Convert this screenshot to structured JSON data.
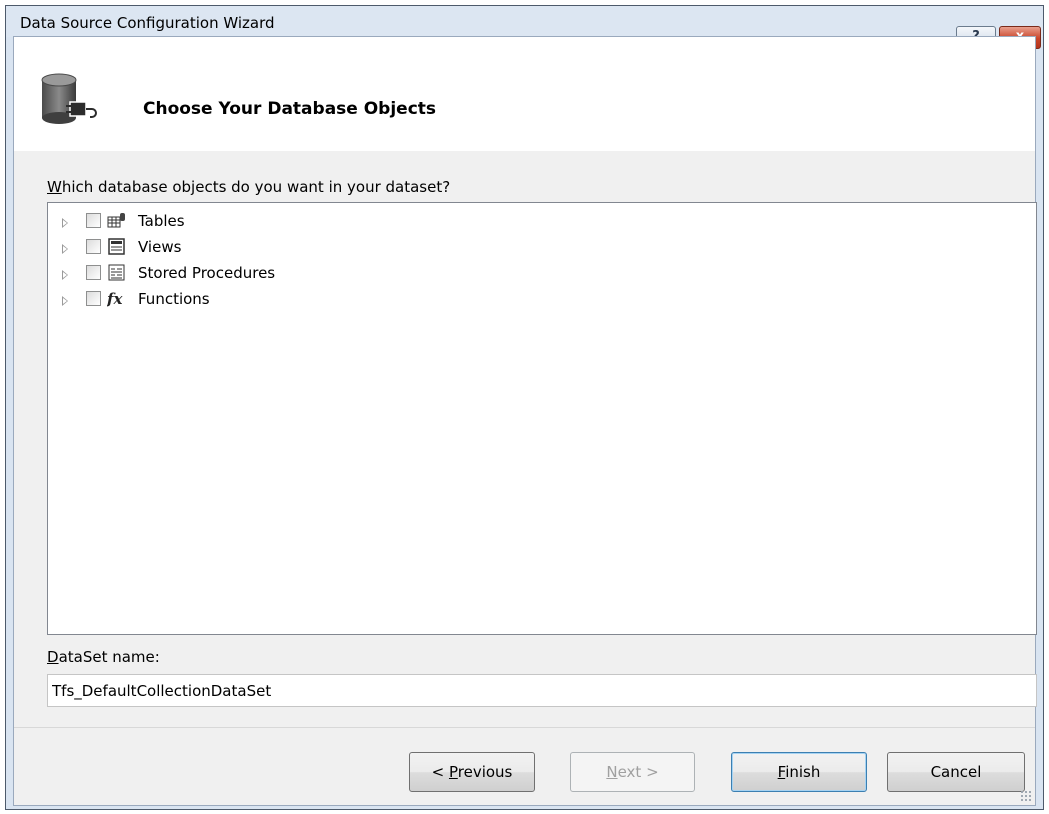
{
  "window": {
    "title": "Data Source Configuration Wizard",
    "help_label": "?",
    "close_label": "x"
  },
  "header": {
    "title": "Choose Your Database Objects",
    "icon": "database-connect-icon"
  },
  "objects": {
    "prompt_prefix": "W",
    "prompt_rest": "hich database objects do you want in your dataset?",
    "items": [
      {
        "label": "Tables",
        "icon": "table-icon",
        "checked": false
      },
      {
        "label": "Views",
        "icon": "view-icon",
        "checked": false
      },
      {
        "label": "Stored Procedures",
        "icon": "stored-procedure-icon",
        "checked": false
      },
      {
        "label": "Functions",
        "icon": "function-icon",
        "checked": false
      }
    ]
  },
  "dataset": {
    "label_prefix": "D",
    "label_rest": "ataSet name:",
    "value": "Tfs_DefaultCollectionDataSet"
  },
  "buttons": {
    "previous_prefix": "< ",
    "previous_key": "P",
    "previous_rest": "revious",
    "next_key": "N",
    "next_rest": "ext >",
    "finish_key": "F",
    "finish_rest": "inish",
    "cancel": "Cancel"
  }
}
